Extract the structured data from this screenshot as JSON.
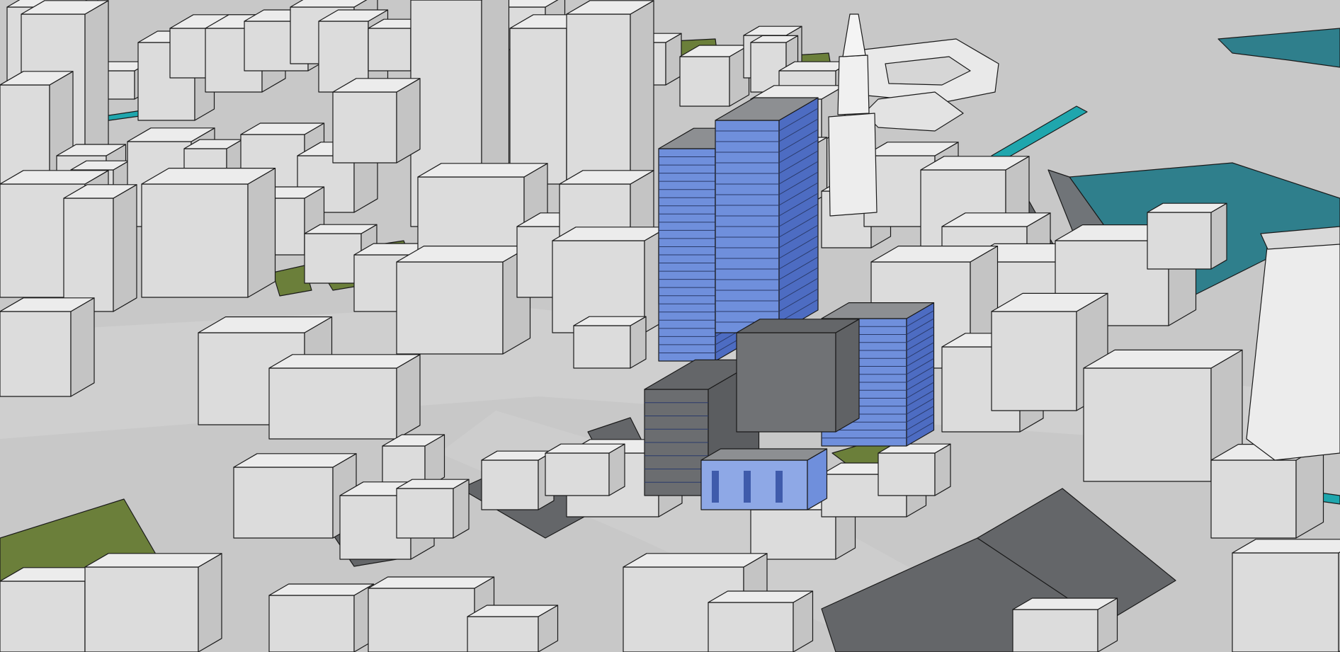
{
  "viewport": {
    "label": "",
    "palette": {
      "ground": "#c8c8c8",
      "road": "#d2d2d2",
      "building_top": "#ececec",
      "building_left": "#dcdcdc",
      "building_right": "#c4c4c4",
      "glass_light": "#8ea8e6",
      "glass_mid": "#6f8fdc",
      "glass_dark": "#4d6cc2",
      "parking": "#646669",
      "parking_dark": "#55575a",
      "grass": "#6b7f3a",
      "water": "#2f7f8c",
      "water_channel": "#1fa6ad",
      "outline": "#1a1a1a"
    },
    "layers": [
      "terrain",
      "water",
      "roads",
      "parking",
      "grass",
      "buildings",
      "proposed-glass-towers",
      "stadium",
      "terminal-tower"
    ]
  }
}
